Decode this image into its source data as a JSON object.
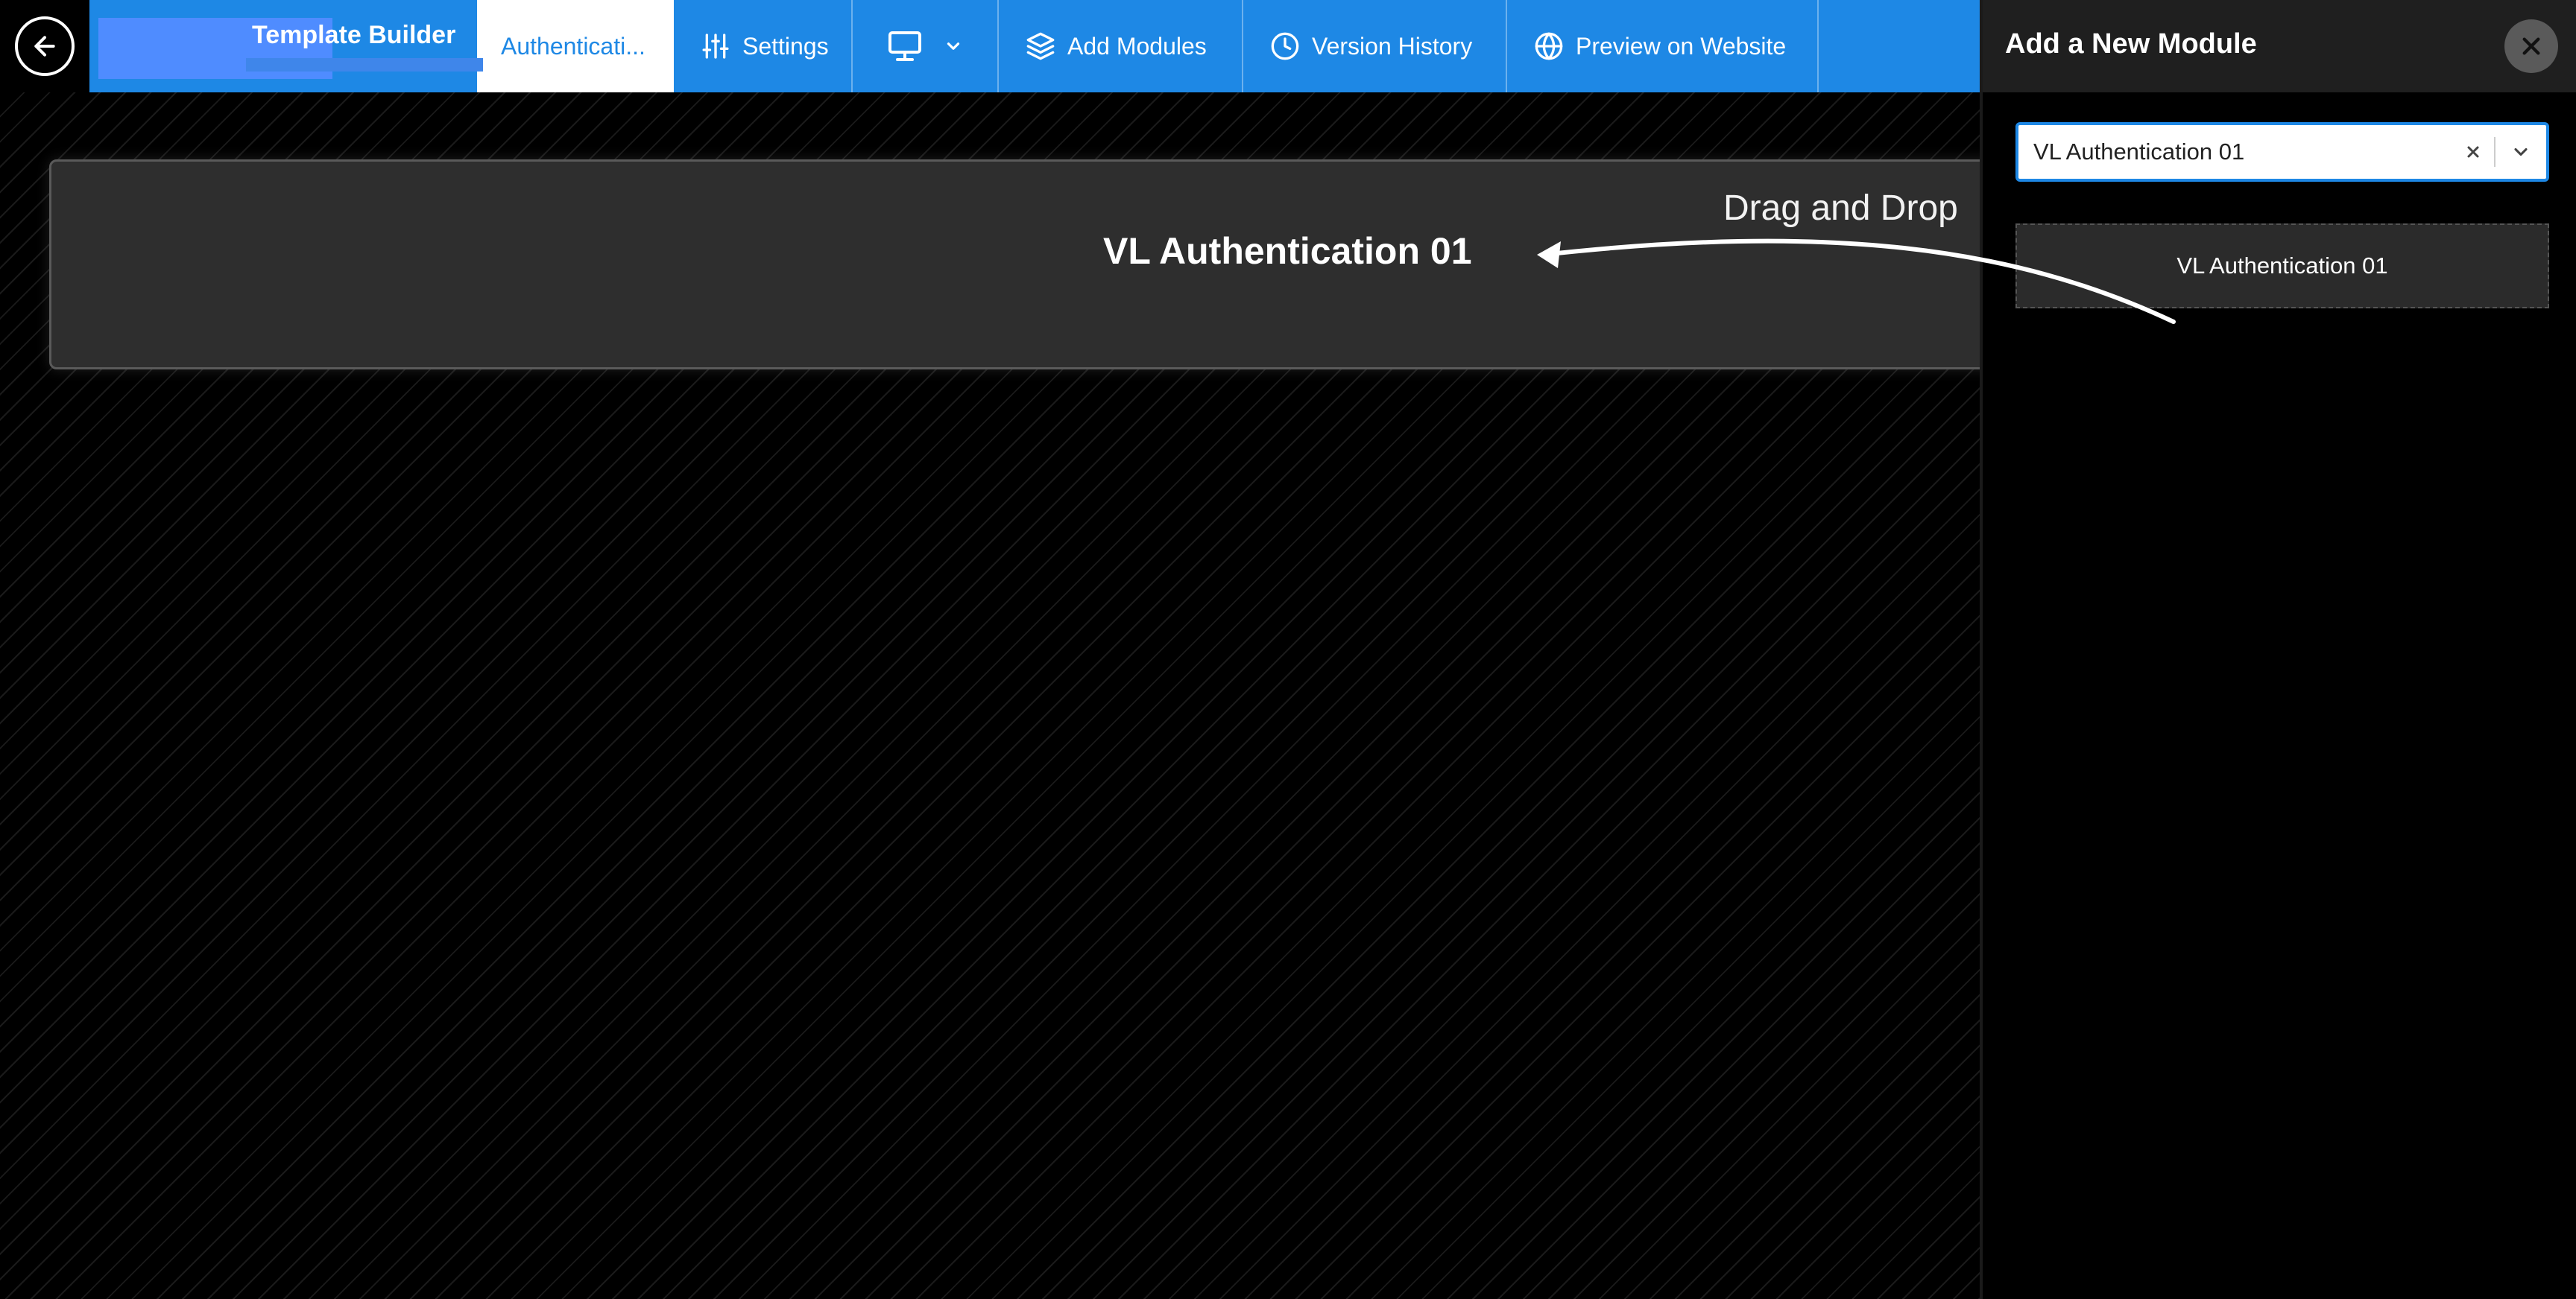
{
  "header": {
    "back_icon": "arrow-left-icon",
    "brand_title": "Template Builder",
    "tabs": [
      {
        "label": "Authenticati...",
        "icon": "",
        "active": true
      },
      {
        "label": "Settings",
        "icon": "sliders-icon"
      },
      {
        "label": "",
        "icon": "monitor-icon"
      },
      {
        "label": "Add Modules",
        "icon": "layers-icon"
      },
      {
        "label": "Version History",
        "icon": "clock-icon"
      },
      {
        "label": "Preview on Website",
        "icon": "globe-icon"
      }
    ]
  },
  "canvas": {
    "module_title": "VL Authentication 01",
    "drag_hint": "Drag and Drop"
  },
  "panel": {
    "title": "Add a New Module",
    "close_icon": "close-icon",
    "select": {
      "value": "VL Authentication 01"
    },
    "modules": [
      {
        "label": "VL Authentication 01"
      }
    ]
  },
  "colors": {
    "accent": "#1e88e5",
    "panel_header": "#1f1f1f",
    "module_block": "#2e2e2e"
  }
}
